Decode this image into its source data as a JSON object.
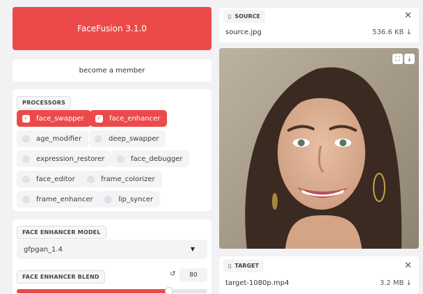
{
  "app_title": "FaceFusion 3.1.0",
  "member_button": "become a member",
  "processors": {
    "label": "PROCESSORS",
    "items": [
      {
        "label": "face_swapper",
        "checked": true
      },
      {
        "label": "face_enhancer",
        "checked": true
      },
      {
        "label": "age_modifier",
        "checked": false
      },
      {
        "label": "deep_swapper",
        "checked": false
      },
      {
        "label": "expression_restorer",
        "checked": false
      },
      {
        "label": "face_debugger",
        "checked": false
      },
      {
        "label": "face_editor",
        "checked": false
      },
      {
        "label": "frame_colorizer",
        "checked": false
      },
      {
        "label": "frame_enhancer",
        "checked": false
      },
      {
        "label": "lip_syncer",
        "checked": false
      }
    ]
  },
  "enhancer_model": {
    "label": "FACE ENHANCER MODEL",
    "selected": "gfpgan_1.4"
  },
  "enhancer_blend": {
    "label": "FACE ENHANCER BLEND",
    "value": "80",
    "fraction": 0.8
  },
  "source": {
    "label": "SOURCE",
    "file_name": "source.jpg",
    "file_size": "536.6 KB ↓"
  },
  "target": {
    "label": "TARGET",
    "file_name": "target-1080p.mp4",
    "file_size": "3.2 MB ↓"
  },
  "colors": {
    "accent": "#ec4a4a",
    "background": "#f2f2f4"
  }
}
